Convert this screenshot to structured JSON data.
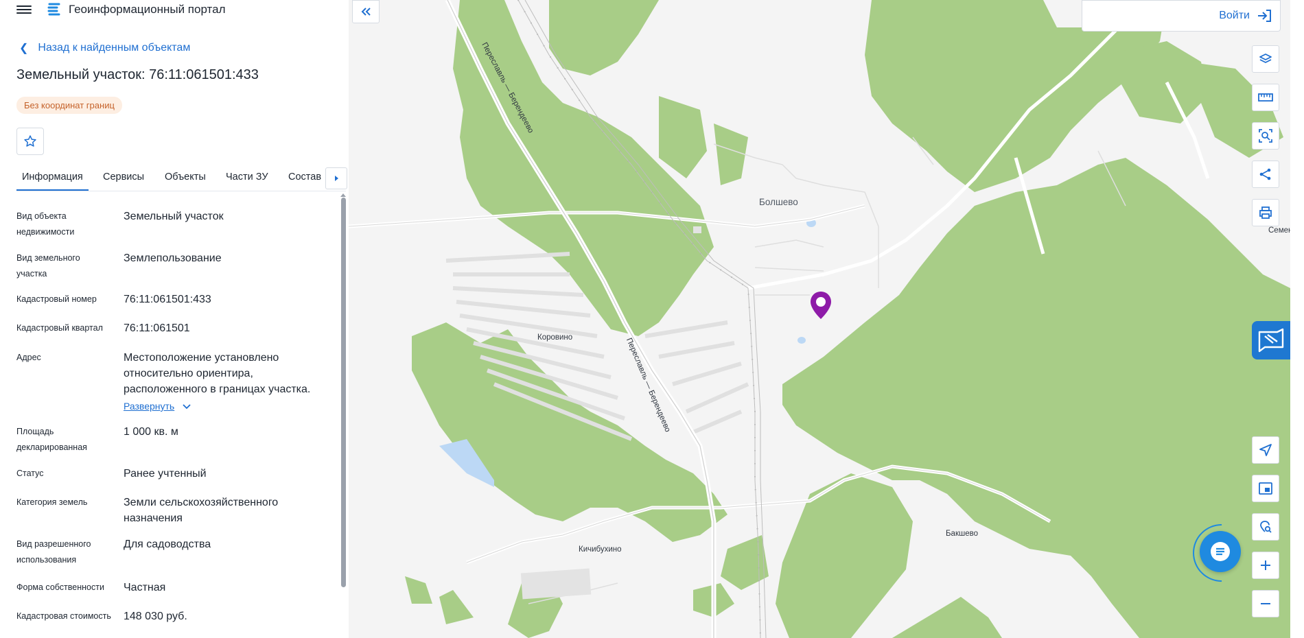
{
  "header": {
    "title": "Геоинформационный портал",
    "menu_icon": "menu-icon",
    "logo_icon": "portal-logo"
  },
  "nav": {
    "back_label": "Назад к найденным объектам"
  },
  "object": {
    "title": "Земельный участок: 76:11:061501:433",
    "badge": "Без координат границ",
    "favorite_icon": "star-icon"
  },
  "tabs": [
    {
      "label": "Информация",
      "active": true
    },
    {
      "label": "Сервисы",
      "active": false
    },
    {
      "label": "Объекты",
      "active": false
    },
    {
      "label": "Части ЗУ",
      "active": false
    },
    {
      "label": "Состав",
      "active": false
    }
  ],
  "properties": [
    {
      "label": "Вид объекта недвижимости",
      "value": "Земельный участок"
    },
    {
      "label": "Вид земельного участка",
      "value": "Землепользование"
    },
    {
      "label": "Кадастровый номер",
      "value": "76:11:061501:433"
    },
    {
      "label": "Кадастровый квартал",
      "value": "76:11:061501"
    },
    {
      "label": "Адрес",
      "value": "Местоположение установлено относительно ориентира, расположенного в границах участка.",
      "expand_label": "Развернуть"
    },
    {
      "label": "Площадь декларированная",
      "value": "1 000 кв. м"
    },
    {
      "label": "Статус",
      "value": "Ранее учтенный"
    },
    {
      "label": "Категория земель",
      "value": "Земли сельскохозяйственного назначения"
    },
    {
      "label": "Вид разрешенного использования",
      "value": "Для садоводства"
    },
    {
      "label": "Форма собственности",
      "value": "Частная"
    },
    {
      "label": "Кадастровая стоимость",
      "value": "148 030 руб."
    }
  ],
  "map": {
    "login_label": "Войти",
    "places": {
      "bolshevo": "Болшево",
      "korovino": "Коровино",
      "kichibukhino": "Кичибухино",
      "bakshevo": "Бакшево",
      "semen": "Семен"
    },
    "road_label": "Переславль — Берендеево",
    "colors": {
      "forest": "#a8cd87",
      "water": "#bcd8f5",
      "background": "#f4f4f4",
      "accent": "#1f6fd1",
      "pin": "#8e1ba8"
    },
    "tools": [
      "layers-icon",
      "ruler-icon",
      "area-select-icon",
      "share-icon",
      "print-icon",
      "locate-icon",
      "minimap-icon",
      "geo-search-icon",
      "zoom-in-icon",
      "zoom-out-icon"
    ]
  }
}
